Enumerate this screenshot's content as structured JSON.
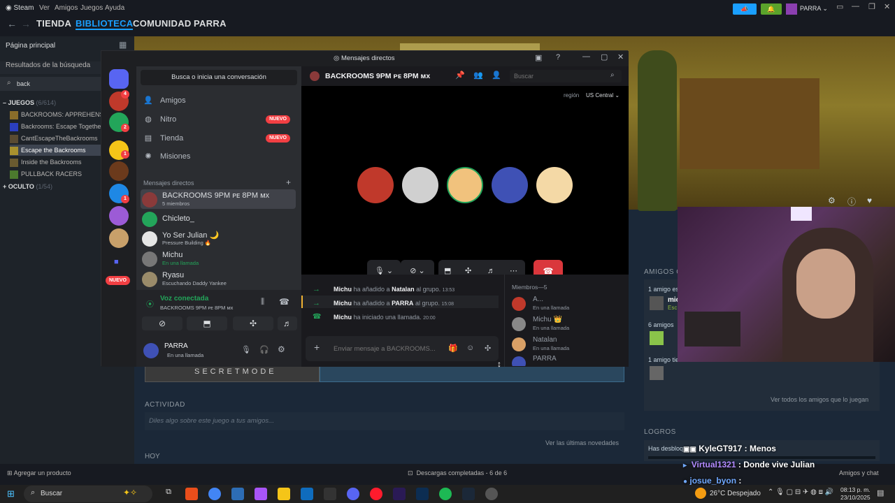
{
  "steam": {
    "menubar": {
      "app": "Steam",
      "items": [
        "Ver",
        "Amigos",
        "Juegos",
        "Ayuda"
      ],
      "user": "PARRA"
    },
    "nav": {
      "tabs": [
        "TIENDA",
        "BIBLIOTECA",
        "COMUNIDAD",
        "PARRA"
      ],
      "active": "BIBLIOTECA"
    },
    "sidebar": {
      "home": "Página principal",
      "filter": "Resultados de la búsqueda",
      "search_value": "back",
      "games_header": "JUEGOS",
      "games_count": "(6/614)",
      "games": [
        "BACKROOMS: APPREHENSI",
        "Backrooms: Escape Togethe",
        "CantEscapeTheBackrooms",
        "Escape the Backrooms",
        "Inside the Backrooms",
        "PULLBACK RACERS"
      ],
      "selected_game": "Escape the Backrooms",
      "hidden_header": "OCULTO",
      "hidden_count": "(1/54)"
    },
    "main": {
      "banner_text": "SECRETMODE",
      "activity_header": "ACTIVIDAD",
      "activity_placeholder": "Diles algo sobre este juego a tus amigos...",
      "news_link": "Ver las últimas novedades",
      "today_header": "HOY",
      "friends_header": "AMIGOS Q",
      "friends_line1": "1 amigo es",
      "friends_name1": "mic",
      "friends_sub1": "Esc",
      "friends_line2": "6 amigos",
      "friends_line3": "1 amigo tie",
      "friends_link": "Ver todos los amigos que lo juegan",
      "achievements_header": "LOGROS",
      "achievements_text": "Has desbloq"
    },
    "bottom": {
      "add": "Agregar un producto",
      "downloads": "Descargas completadas - 6 de 6",
      "friends": "Amigos y chat"
    }
  },
  "discord": {
    "title": "Mensajes directos",
    "search_conv": "Busca o inicia una conversación",
    "nav": [
      {
        "label": "Amigos",
        "icon": "friends-icon",
        "badge": ""
      },
      {
        "label": "Nitro",
        "icon": "nitro-icon",
        "badge": "NUEVO"
      },
      {
        "label": "Tienda",
        "icon": "shop-icon",
        "badge": "NUEVO"
      },
      {
        "label": "Misiones",
        "icon": "quests-icon",
        "badge": ""
      }
    ],
    "dm_header": "Mensajes directos",
    "dms": [
      {
        "name": "BACKROOMS 9PM ᴘᴇ 8PM ᴍx",
        "sub": "5 miembros",
        "color": "#8a3a3a"
      },
      {
        "name": "Chicleto_",
        "sub": "",
        "color": "#23a55a"
      },
      {
        "name": "Yo Ser Julian 🌙",
        "sub": "Pressure Building 🔥",
        "color": "#e6e6e6"
      },
      {
        "name": "Michu",
        "sub": "En una llamada",
        "color": "#777"
      },
      {
        "name": "Ryasu",
        "sub": "Escuchando Daddy Yankee",
        "color": "#9a8b6a"
      }
    ],
    "servers_new_badge": "NUEVO",
    "server_badges": [
      "4",
      "2",
      "1",
      "1"
    ],
    "voice": {
      "status": "Voz conectada",
      "channel": "BACKROOMS 9PM ᴘᴇ 8PM ᴍx"
    },
    "user": {
      "name": "PARRA",
      "status": "En una llamada"
    },
    "header": {
      "channel": "BACKROOMS 9PM ᴘᴇ 8PM ᴍx",
      "search_placeholder": "Buscar",
      "region_label": "región",
      "region_value": "US Central"
    },
    "call_avatars": [
      "#c0392b",
      "#d0d0d0",
      "#f1c27d",
      "#3f51b5",
      "#f4d9a6"
    ],
    "messages": [
      {
        "actor": "Michu",
        "text": "ha añadido a",
        "target": "Natalan",
        "suffix": "al grupo.",
        "time": "13:53"
      },
      {
        "actor": "Michu",
        "text": "ha añadido a",
        "target": "PARRA",
        "suffix": "al grupo.",
        "time": "15:08"
      },
      {
        "actor": "Michu",
        "text": "ha iniciado una llamada.",
        "target": "",
        "suffix": "",
        "time": "20:00"
      }
    ],
    "composer_placeholder": "Enviar mensaje a BACKROOMS...",
    "members_header": "Miembros—5",
    "members": [
      {
        "name": "A...",
        "sub": "En una llamada",
        "color": "#c0392b"
      },
      {
        "name": "Michu 👑",
        "sub": "En una llamada",
        "color": "#888"
      },
      {
        "name": "Natalan",
        "sub": "En una llamada",
        "color": "#d9a066"
      },
      {
        "name": "PARRA",
        "sub": "",
        "color": "#3f51b5"
      }
    ]
  },
  "chat_overlay": [
    {
      "user": "KyleGT917",
      "text": ": Menos",
      "color": "#ffffff"
    },
    {
      "user": "Virtual1321",
      "text": ": Donde vive Julian",
      "color": "#b38bff"
    },
    {
      "user": "josue_byon",
      "text": ":",
      "color": "#6fa8ff"
    }
  ],
  "taskbar": {
    "search": "Buscar",
    "weather": "26°C  Despejado",
    "time": "08:13 p. m.",
    "date": "23/10/2025"
  }
}
